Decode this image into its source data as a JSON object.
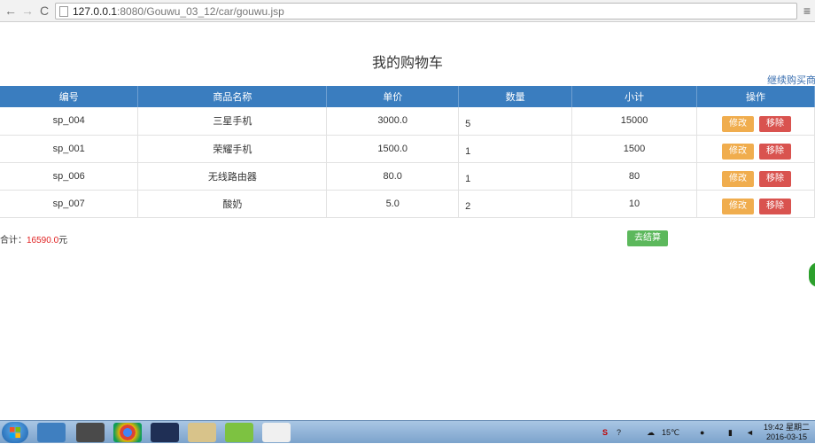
{
  "browser": {
    "nav_back": "←",
    "nav_forward": "→",
    "nav_reload": "C",
    "url_host": "127.0.0.1",
    "url_path": ":8080/Gouwu_03_12/car/gouwu.jsp",
    "menu": "≡"
  },
  "page": {
    "title": "我的购物车",
    "continue_link": "继续购买商品"
  },
  "table": {
    "headers": [
      "编号",
      "商品名称",
      "单价",
      "数量",
      "小计",
      "操作"
    ],
    "rows": [
      {
        "id": "sp_004",
        "name": "三星手机",
        "price": "3000.0",
        "qty": "5",
        "subtotal": "15000"
      },
      {
        "id": "sp_001",
        "name": "荣耀手机",
        "price": "1500.0",
        "qty": "1",
        "subtotal": "1500"
      },
      {
        "id": "sp_006",
        "name": "无线路由器",
        "price": "80.0",
        "qty": "1",
        "subtotal": "80"
      },
      {
        "id": "sp_007",
        "name": "酸奶",
        "price": "5.0",
        "qty": "2",
        "subtotal": "10"
      }
    ],
    "edit_label": "修改",
    "delete_label": "移除"
  },
  "summary": {
    "label": "合计：",
    "amount": "16590.0",
    "unit": "元",
    "checkout_label": "去结算"
  },
  "taskbar": {
    "weather": "15℃",
    "time": "19:42 星期二",
    "date": "2016-03-15"
  },
  "colors": {
    "header_bg": "#3a7dbf",
    "edit_btn": "#f0ad4e",
    "delete_btn": "#d9534f",
    "checkout_btn": "#5cb85c",
    "amount": "#e02020"
  }
}
